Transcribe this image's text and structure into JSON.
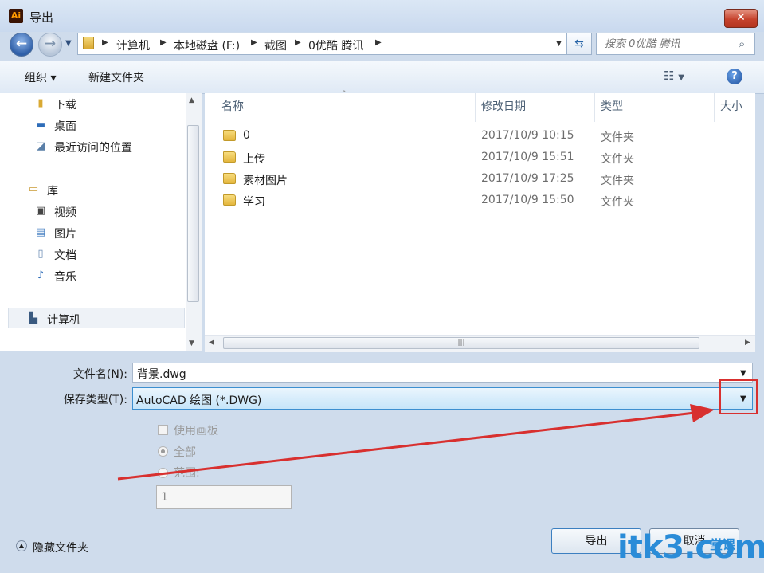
{
  "window": {
    "title": "导出",
    "app_icon": "Ai",
    "close_label": "✕"
  },
  "nav": {
    "breadcrumbs": [
      "计算机",
      "本地磁盘 (F:)",
      "截图",
      "0优酷 腾讯"
    ],
    "search_placeholder": "搜索 0优酷 腾讯"
  },
  "toolbar": {
    "organize": "组织 ▾",
    "new_folder": "新建文件夹",
    "help": "?"
  },
  "sidebar": {
    "items": [
      {
        "label": "下载",
        "icon": "download-folder-icon"
      },
      {
        "label": "桌面",
        "icon": "desktop-icon"
      },
      {
        "label": "最近访问的位置",
        "icon": "recent-places-icon"
      },
      {
        "label": "库",
        "icon": "library-icon"
      },
      {
        "label": "视频",
        "icon": "videos-icon"
      },
      {
        "label": "图片",
        "icon": "pictures-icon"
      },
      {
        "label": "文档",
        "icon": "documents-icon"
      },
      {
        "label": "音乐",
        "icon": "music-icon"
      },
      {
        "label": "计算机",
        "icon": "computer-icon"
      }
    ]
  },
  "files": {
    "columns": [
      "名称",
      "修改日期",
      "类型",
      "大小"
    ],
    "rows": [
      {
        "name": "0",
        "date": "2017/10/9 10:15",
        "type": "文件夹"
      },
      {
        "name": "上传",
        "date": "2017/10/9 15:51",
        "type": "文件夹"
      },
      {
        "name": "素材图片",
        "date": "2017/10/9 17:25",
        "type": "文件夹"
      },
      {
        "name": "学习",
        "date": "2017/10/9 15:50",
        "type": "文件夹"
      }
    ]
  },
  "form": {
    "filename_label": "文件名(N):",
    "filename_value": "背景.dwg",
    "filetype_label": "保存类型(T):",
    "filetype_value": "AutoCAD 绘图 (*.DWG)",
    "use_artboards": "使用画板",
    "all": "全部",
    "range": "范围:",
    "range_value": "1"
  },
  "footer": {
    "hide_folders": "隐藏文件夹",
    "export": "导出",
    "cancel": "取消"
  },
  "watermark": {
    "text": "itk3.com",
    "sub": "堂课"
  },
  "colors": {
    "annotation": "#d8302f",
    "accent": "#3c8fd0"
  }
}
